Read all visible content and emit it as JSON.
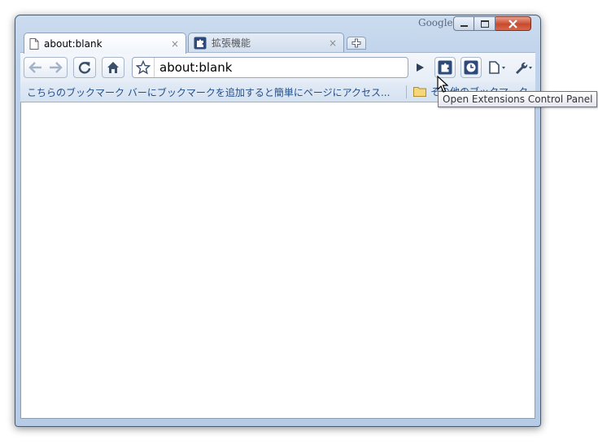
{
  "window": {
    "brand_label": "Google"
  },
  "tabs": [
    {
      "title": "about:blank",
      "close_glyph": "×",
      "icon": "page-icon",
      "active": true
    },
    {
      "title": "拡張機能",
      "close_glyph": "×",
      "icon": "extensions-puzzle-icon",
      "active": false
    }
  ],
  "toolbar": {
    "back_icon": "back-arrow-icon",
    "forward_icon": "forward-arrow-icon",
    "reload_icon": "reload-icon",
    "home_icon": "home-icon",
    "bookmark_star_icon": "star-icon",
    "url": "about:blank",
    "go_icon": "go-play-icon",
    "extensions_icon": "extensions-puzzle-icon",
    "history_icon": "clock-icon",
    "page_menu_icon": "page-menu-icon",
    "tools_menu_icon": "wrench-icon"
  },
  "bookmark_bar": {
    "hint": "こちらのブックマーク バーにブックマークを追加すると簡単にページにアクセス...",
    "other_bookmarks": "その他のブックマーク"
  },
  "tooltip": {
    "text": "Open Extensions Control Panel"
  },
  "colors": {
    "frame": "#bed2ea",
    "link_text": "#274f86",
    "extensions_button": "#2e4a7a"
  }
}
